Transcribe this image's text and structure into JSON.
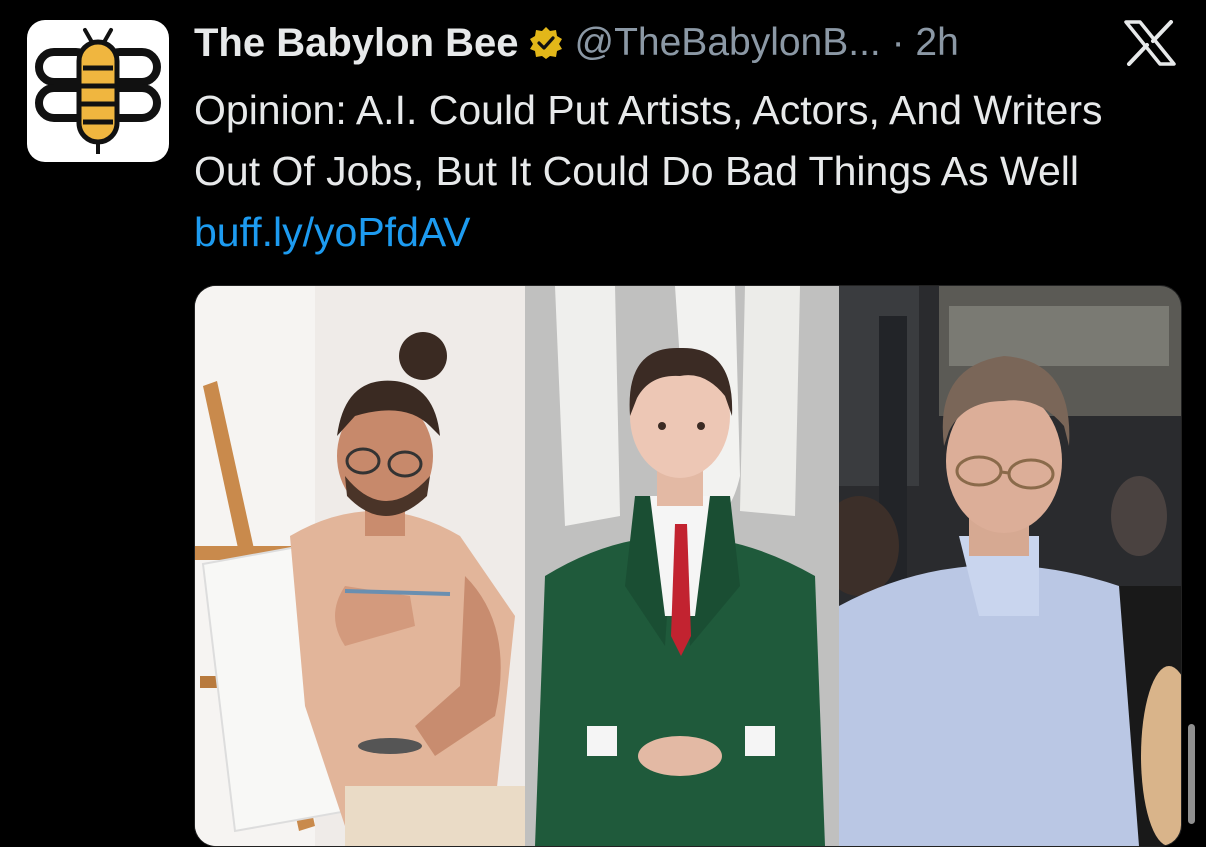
{
  "tweet": {
    "author_name": "The Babylon Bee",
    "handle_time": "@TheBabylonB... · 2h",
    "text": "Opinion: A.I. Could Put Artists, Actors, And Writers Out Of Jobs, But It Could Do Bad Things As Well",
    "link": "buff.ly/yoPfdAV"
  },
  "icons": {
    "verified": "verified-badge-icon",
    "platform": "x-logo-icon"
  },
  "colors": {
    "background": "#000000",
    "text": "#e7e9ea",
    "secondary_text": "#8b98a5",
    "link": "#1d9bf0",
    "verified_badge": "#e2b719"
  }
}
